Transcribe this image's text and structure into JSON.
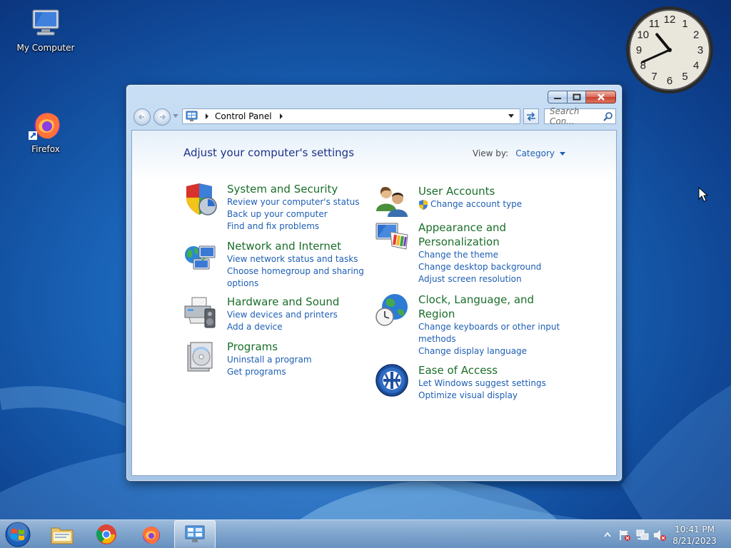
{
  "desktop": {
    "icons": [
      {
        "label": "My Computer"
      },
      {
        "label": "Firefox"
      }
    ]
  },
  "clock_gadget": {
    "numerals": [
      "12",
      "1",
      "2",
      "3",
      "4",
      "5",
      "6",
      "7",
      "8",
      "9",
      "10",
      "11"
    ],
    "time_shown": "10:41"
  },
  "window": {
    "address": {
      "crumb": "Control Panel"
    },
    "search": {
      "placeholder": "Search Con..."
    },
    "heading": "Adjust your computer's settings",
    "view_by": {
      "label": "View by:",
      "value": "Category"
    },
    "categories": [
      {
        "title": "System and Security",
        "icon": "shield-icon",
        "links": [
          "Review your computer's status",
          "Back up your computer",
          "Find and fix problems"
        ]
      },
      {
        "title": "Network and Internet",
        "icon": "network-globe-icon",
        "links": [
          "View network status and tasks",
          "Choose homegroup and sharing options"
        ]
      },
      {
        "title": "Hardware and Sound",
        "icon": "printer-icon",
        "links": [
          "View devices and printers",
          "Add a device"
        ]
      },
      {
        "title": "Programs",
        "icon": "programs-icon",
        "links": [
          "Uninstall a program",
          "Get programs"
        ]
      },
      {
        "title": "User Accounts",
        "icon": "users-icon",
        "links": [
          "Change account type"
        ]
      },
      {
        "title": "Appearance and Personalization",
        "icon": "monitor-palette-icon",
        "links": [
          "Change the theme",
          "Change desktop background",
          "Adjust screen resolution"
        ]
      },
      {
        "title": "Clock, Language, and Region",
        "icon": "clock-globe-icon",
        "links": [
          "Change keyboards or other input methods",
          "Change display language"
        ]
      },
      {
        "title": "Ease of Access",
        "icon": "ease-of-access-icon",
        "links": [
          "Let Windows suggest settings",
          "Optimize visual display"
        ]
      }
    ]
  },
  "taskbar": {
    "time": "10:41 PM",
    "date": "8/21/2023"
  },
  "colors": {
    "link": "#1e5fb4",
    "category_title": "#1a6e2a",
    "heading": "#1e3287",
    "desktop": "#1a64b8"
  }
}
